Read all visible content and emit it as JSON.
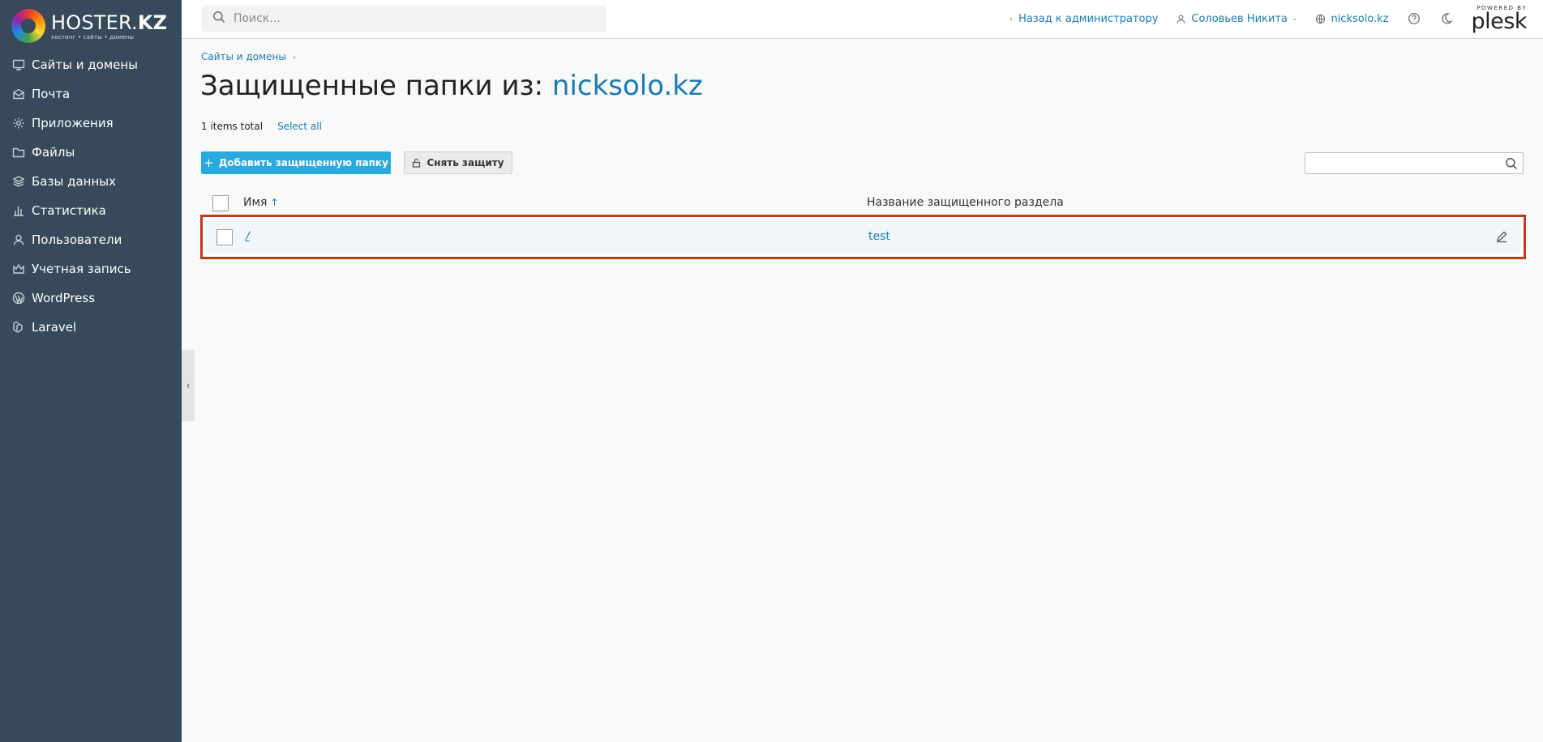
{
  "brand": {
    "logo_main": "HOSTER.",
    "logo_bold": "KZ",
    "logo_tagline": "хостинг • сайты • домены"
  },
  "sidebar": {
    "items": [
      {
        "label": "Сайты и домены",
        "icon": "monitor-icon"
      },
      {
        "label": "Почта",
        "icon": "mail-icon"
      },
      {
        "label": "Приложения",
        "icon": "gear-icon"
      },
      {
        "label": "Файлы",
        "icon": "folder-icon"
      },
      {
        "label": "Базы данных",
        "icon": "layers-icon"
      },
      {
        "label": "Статистика",
        "icon": "bar-chart-icon"
      },
      {
        "label": "Пользователи",
        "icon": "user-icon"
      },
      {
        "label": "Учетная запись",
        "icon": "crown-icon"
      },
      {
        "label": "WordPress",
        "icon": "wordpress-icon"
      },
      {
        "label": "Laravel",
        "icon": "laravel-icon"
      }
    ],
    "collapse_glyph": "‹"
  },
  "topbar": {
    "search_placeholder": "Поиск...",
    "back_to_admin": "Назад к администратору",
    "user_name": "Соловьев Никита",
    "domain_link": "nicksolo.kz",
    "powered_by": "POWERED BY",
    "plesk": "plesk"
  },
  "breadcrumb": {
    "item": "Сайты и домены"
  },
  "page": {
    "title_prefix": "Защищенные папки из: ",
    "title_domain": "nicksolo.kz",
    "items_total": "1 items total",
    "select_all": "Select all"
  },
  "toolbar": {
    "add_label": "Добавить защищенную папку",
    "remove_label": "Снять защиту"
  },
  "table": {
    "columns": {
      "name": "Имя",
      "sort_arrow": "↑",
      "realm": "Название защищенного раздела"
    },
    "rows": [
      {
        "name": "/",
        "realm": "test"
      }
    ]
  },
  "colors": {
    "sidebar_bg": "#37495a",
    "accent": "#1b7bb5",
    "primary_button": "#28aade",
    "highlight_border": "#c0391b"
  }
}
